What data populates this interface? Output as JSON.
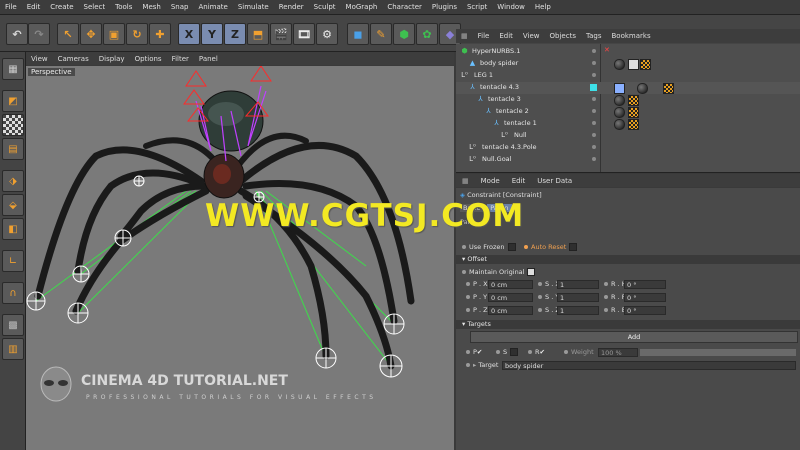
{
  "menubar": [
    "File",
    "Edit",
    "Create",
    "Select",
    "Tools",
    "Mesh",
    "Snap",
    "Animate",
    "Simulate",
    "Render",
    "Sculpt",
    "MoGraph",
    "Character",
    "Plugins",
    "Script",
    "Window",
    "Help"
  ],
  "toolbar": {
    "xyz": [
      "X",
      "Y",
      "Z"
    ]
  },
  "viewport": {
    "menu": [
      "View",
      "Cameras",
      "Display",
      "Options",
      "Filter",
      "Panel"
    ],
    "label": "Perspective"
  },
  "object_manager": {
    "menu": [
      "File",
      "Edit",
      "View",
      "Objects",
      "Tags",
      "Bookmarks"
    ],
    "rows": [
      {
        "name": "HyperNURBS.1"
      },
      {
        "name": "body spider"
      },
      {
        "name": "LEG 1"
      },
      {
        "name": "tentacle 4.3"
      },
      {
        "name": "tentacle 3"
      },
      {
        "name": "tentacle 2"
      },
      {
        "name": "tentacle 1"
      },
      {
        "name": "Null"
      },
      {
        "name": "tentacle 4.3.Pole"
      },
      {
        "name": "Null.Goal"
      }
    ]
  },
  "attributes": {
    "tabs": [
      "Mode",
      "Edit",
      "User Data"
    ],
    "title": "Constraint [Constraint]",
    "subtabs": [
      "Basic",
      "Paren"
    ],
    "pare_label": "Pare",
    "use_frozen": "Use Frozen",
    "auto_reset": "Auto Reset",
    "offset_header": "Offset",
    "maintain_original": "Maintain Original",
    "fields": {
      "px_label": "P . X",
      "px_value": "0 cm",
      "py_label": "P . Y",
      "py_value": "0 cm",
      "pz_label": "P . Z",
      "pz_value": "0 cm",
      "sx_label": "S . X",
      "sx_value": "1",
      "sy_label": "S . Y",
      "sy_value": "1",
      "sz_label": "S . Z",
      "sz_value": "1",
      "rh_label": "R . H",
      "rh_value": "0 °",
      "rp_label": "R . P",
      "rp_value": "0 °",
      "rb_label": "R . B",
      "rb_value": "0 °"
    },
    "targets_header": "Targets",
    "add_button": "Add",
    "p_label": "P",
    "s_label": "S",
    "r_label": "R",
    "weight_label": "Weight",
    "weight_value": "100 %",
    "target_label": "Target",
    "target_value": "body spider"
  },
  "watermark": "WWW.CGTSJ.COM",
  "logo": {
    "title": "CINEMA 4D TUTORIAL.NET",
    "subtitle": "PROFESSIONAL TUTORIALS FOR VISUAL EFFECTS"
  },
  "colors": {
    "accent_yellow": "#f3e923",
    "leg_lines": "#3ddc4a",
    "ik_red": "#ff2a2a",
    "ik_magenta": "#c040ff"
  }
}
